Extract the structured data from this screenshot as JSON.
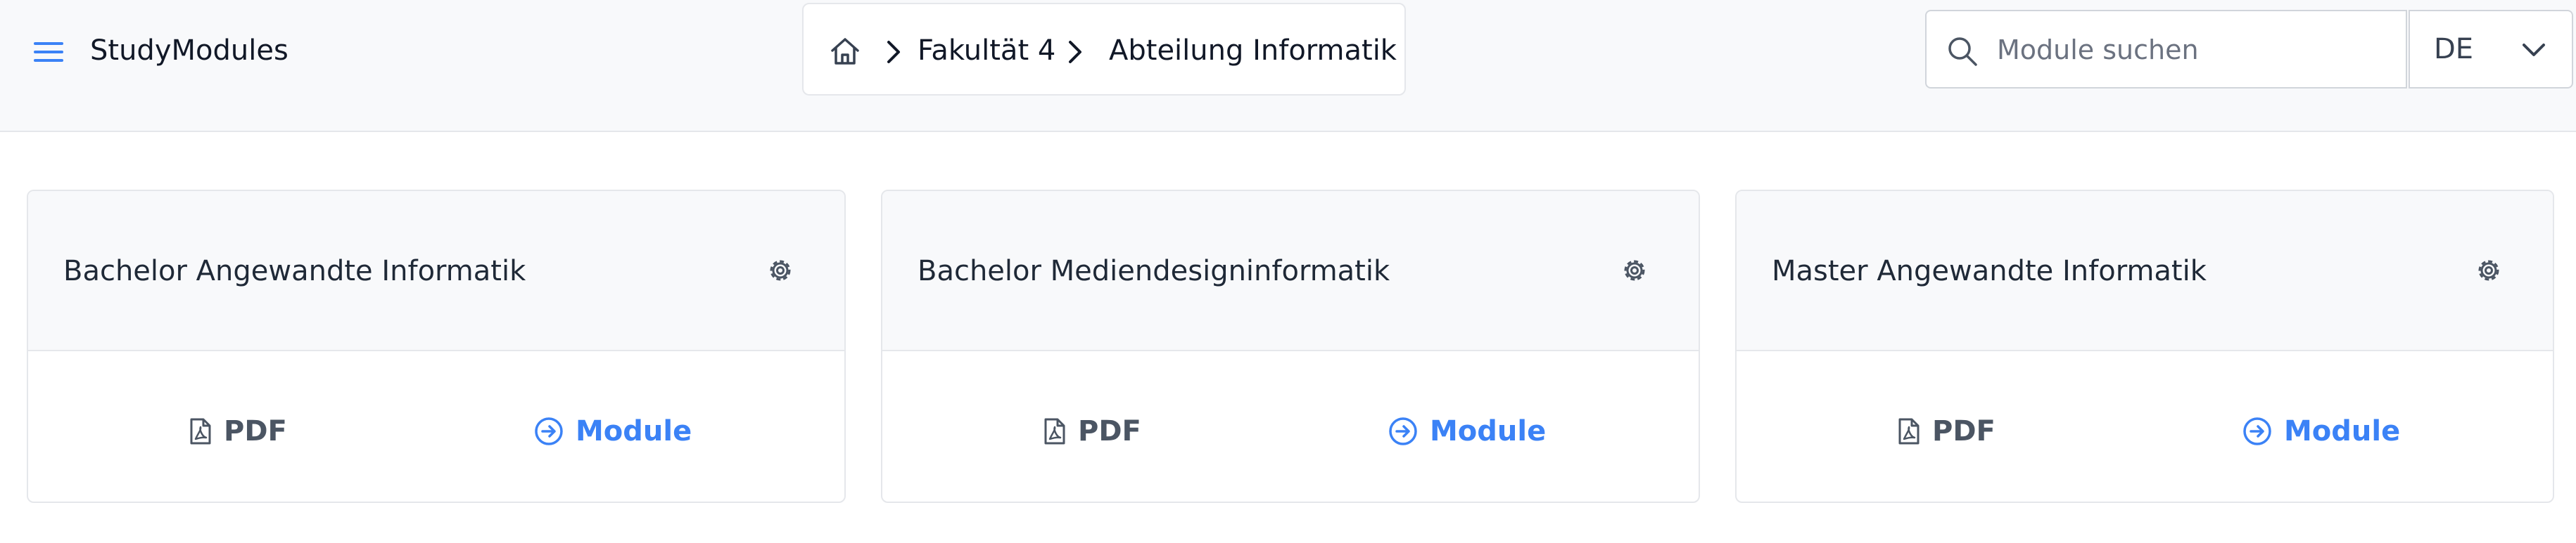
{
  "app": {
    "title": "StudyModules"
  },
  "breadcrumb": {
    "items": [
      "Fakultät 4",
      "Abteilung Informatik"
    ]
  },
  "search": {
    "placeholder": "Module suchen",
    "value": ""
  },
  "language": {
    "selected": "DE"
  },
  "icons": {
    "menu": "hamburger-menu-icon",
    "home": "home-icon",
    "separator": "chevron-right-icon",
    "search": "search-icon",
    "dropdown": "chevron-down-icon",
    "settings": "gear-icon",
    "pdf": "pdf-file-icon",
    "module": "arrow-circle-right-icon"
  },
  "colors": {
    "accent": "#3b82f6",
    "text": "#1f2937",
    "muted": "#4b5563",
    "header_bg": "#f8f9fb",
    "border": "#e5e7eb"
  },
  "cards": [
    {
      "title": "Bachelor Angewandte Informatik",
      "pdf_label": "PDF",
      "module_label": "Module"
    },
    {
      "title": "Bachelor Mediendesigninformatik",
      "pdf_label": "PDF",
      "module_label": "Module"
    },
    {
      "title": "Master Angewandte Informatik",
      "pdf_label": "PDF",
      "module_label": "Module"
    }
  ]
}
